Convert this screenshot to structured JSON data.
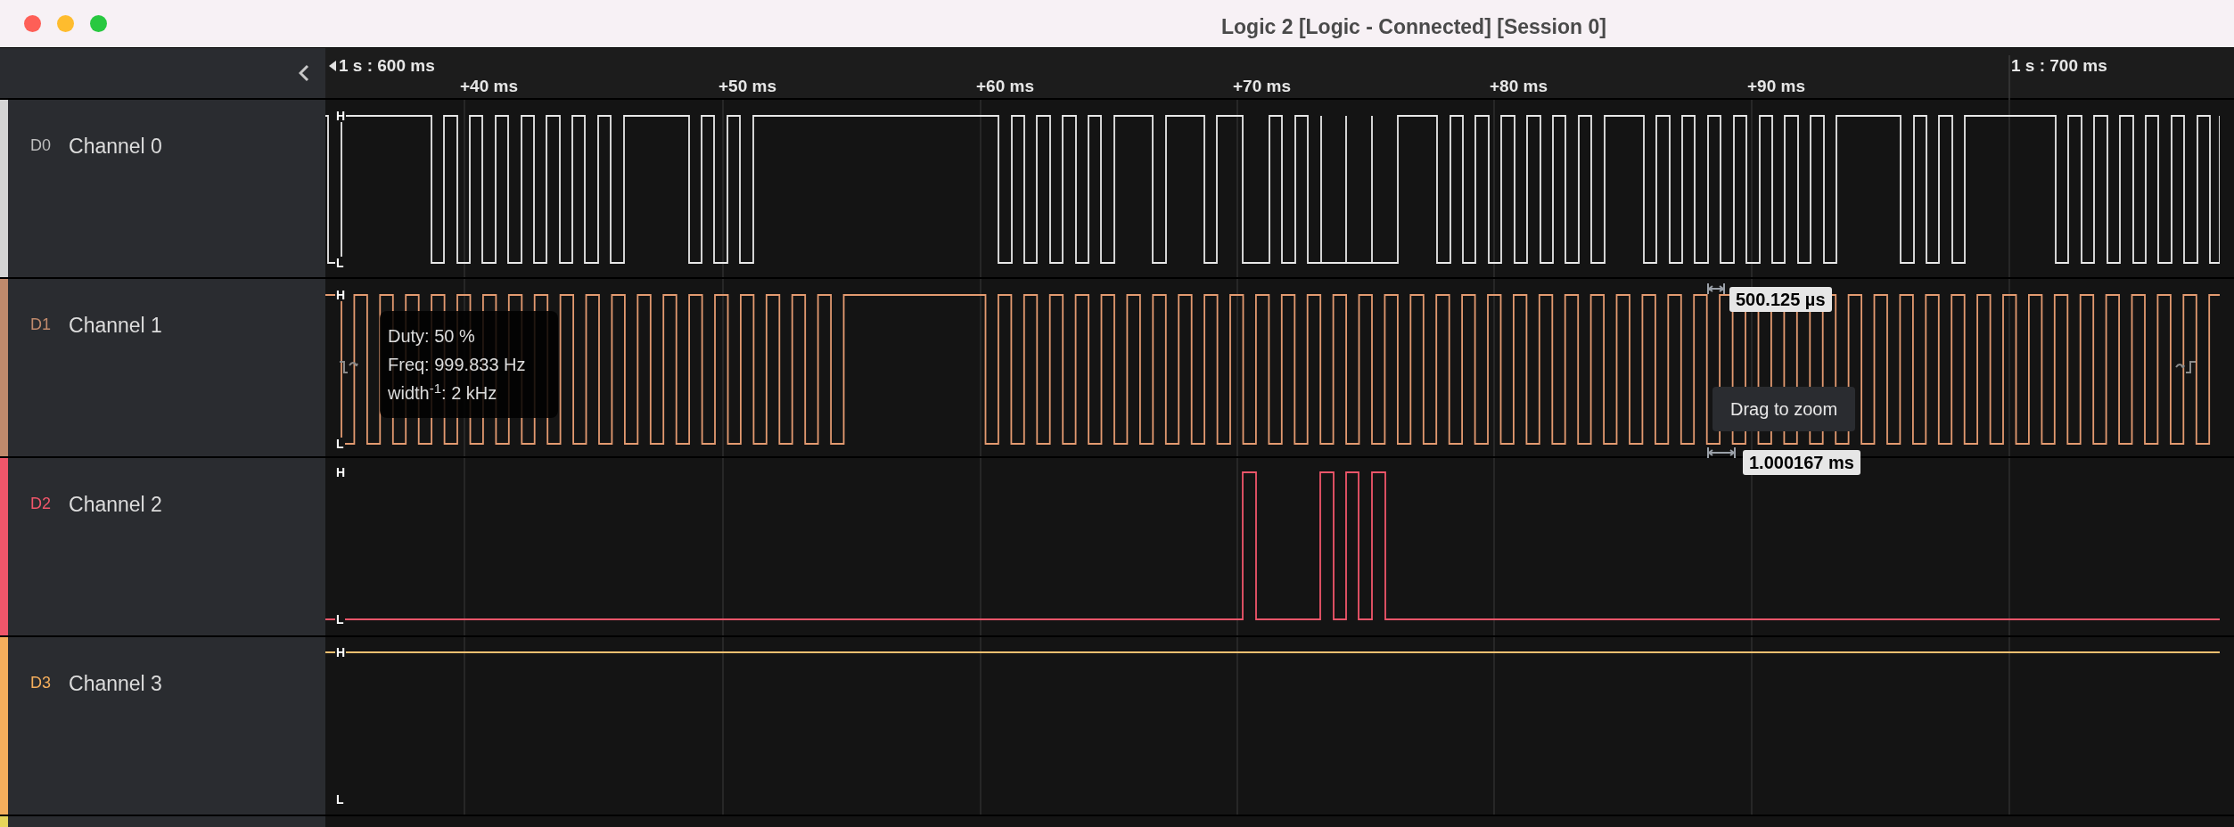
{
  "window": {
    "title": "Logic 2 [Logic - Connected] [Session 0]"
  },
  "timeline": {
    "start_label": "1 s : 600 ms",
    "ticks": [
      "+40 ms",
      "+50 ms",
      "+60 ms",
      "+70 ms",
      "+80 ms",
      "+90 ms"
    ],
    "end_label": "1 s : 700 ms"
  },
  "channels": [
    {
      "id": "D0",
      "name": "Channel 0",
      "color": "#d4d4d4",
      "high_marker": "H",
      "low_marker": "L"
    },
    {
      "id": "D1",
      "name": "Channel 1",
      "color": "#c08a6c",
      "high_marker": "H",
      "low_marker": "L"
    },
    {
      "id": "D2",
      "name": "Channel 2",
      "color": "#f0566a",
      "high_marker": "H",
      "low_marker": "L"
    },
    {
      "id": "D3",
      "name": "Channel 3",
      "color": "#f4ae5c",
      "high_marker": "H",
      "low_marker": "L"
    }
  ],
  "tooltip": {
    "lines": [
      "Duty: 50 %",
      "Freq: 999.833 Hz",
      "width$^{-1}$: 2 kHz"
    ]
  },
  "measurements": [
    {
      "kind": "width",
      "label": "500.125 µs"
    },
    {
      "kind": "period",
      "label": "1.000167 ms"
    }
  ],
  "hint": "Drag to zoom"
}
